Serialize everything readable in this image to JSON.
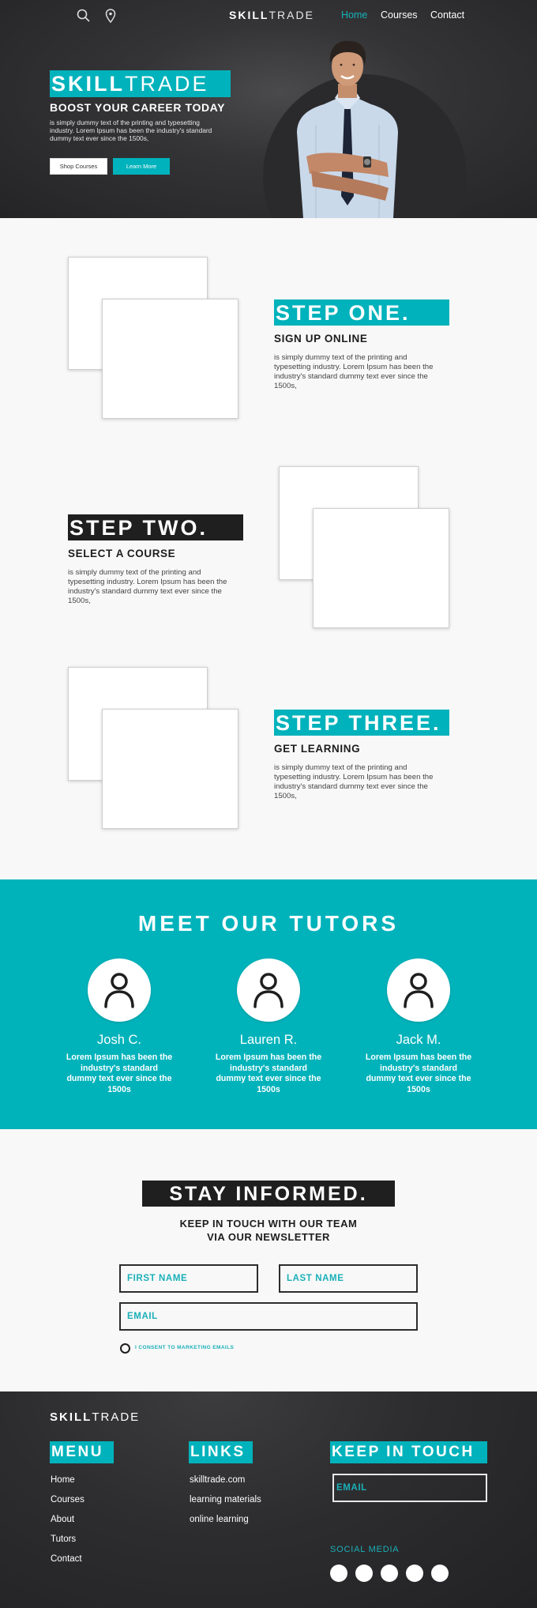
{
  "nav": {
    "icons": [
      "search-icon",
      "location-pin-icon"
    ],
    "logo_bold": "SKILL",
    "logo_light": "TRADE",
    "links": [
      {
        "label": "Home",
        "active": true
      },
      {
        "label": "Courses",
        "active": false
      },
      {
        "label": "Contact",
        "active": false
      }
    ]
  },
  "hero": {
    "brand_bold": "SKILL",
    "brand_light": "TRADE",
    "title": "BOOST YOUR CAREER TODAY",
    "text": "is simply dummy text of the printing and typesetting industry. Lorem Ipsum has been the industry's standard dummy text ever since the 1500s,",
    "buttons": {
      "shop": "Shop Courses",
      "learn": "Learn More"
    },
    "image": "smiling-man-arms-crossed-photo"
  },
  "steps": [
    {
      "label": "STEP ONE.",
      "subtitle": "SIGN UP ONLINE",
      "text": "is simply dummy text of the printing and typesetting industry. Lorem Ipsum has been the industry's standard dummy text ever since the 1500s,",
      "label_style": "teal"
    },
    {
      "label": "STEP TWO.",
      "subtitle": "SELECT A COURSE",
      "text": "is simply dummy text of the printing and typesetting industry. Lorem Ipsum has been the industry's standard dummy text ever since the 1500s,",
      "label_style": "dark"
    },
    {
      "label": "STEP THREE.",
      "subtitle": "GET LEARNING",
      "text": "is simply dummy text of the printing and typesetting industry. Lorem Ipsum has been the industry's standard dummy text ever since the 1500s,",
      "label_style": "teal"
    }
  ],
  "tutors": {
    "title": "MEET OUR TUTORS",
    "items": [
      {
        "name": "Josh C.",
        "bio": "Lorem Ipsum has been the industry's standard dummy text ever since the 1500s"
      },
      {
        "name": "Lauren R.",
        "bio": "Lorem Ipsum has been the industry's standard dummy text ever since the 1500s"
      },
      {
        "name": "Jack M.",
        "bio": "Lorem Ipsum has been the industry's standard dummy text ever since the 1500s"
      }
    ]
  },
  "newsletter": {
    "title": "STAY INFORMED.",
    "subtitle_line1": "KEEP IN TOUCH WITH OUR TEAM",
    "subtitle_line2": "VIA OUR NEWSLETTER",
    "first_name_placeholder": "FIRST NAME",
    "last_name_placeholder": "LAST NAME",
    "email_placeholder": "EMAIL",
    "consent_label": "I CONSENT TO MARKETING EMAILS"
  },
  "footer": {
    "logo_bold": "SKILL",
    "logo_light": "TRADE",
    "menu_title": "MENU",
    "menu_items": [
      "Home",
      "Courses",
      "About",
      "Tutors",
      "Contact"
    ],
    "links_title": "LINKS",
    "links_items": [
      "skilltrade.com",
      "learning materials",
      "online learning"
    ],
    "touch_title": "KEEP IN TOUCH",
    "email_placeholder": "EMAIL",
    "social_label": "SOCIAL MEDIA",
    "social_count": 5
  },
  "colors": {
    "accent": "#00b2bb",
    "dark": "#1f1f1f",
    "page_bg": "#f8f8f8"
  }
}
